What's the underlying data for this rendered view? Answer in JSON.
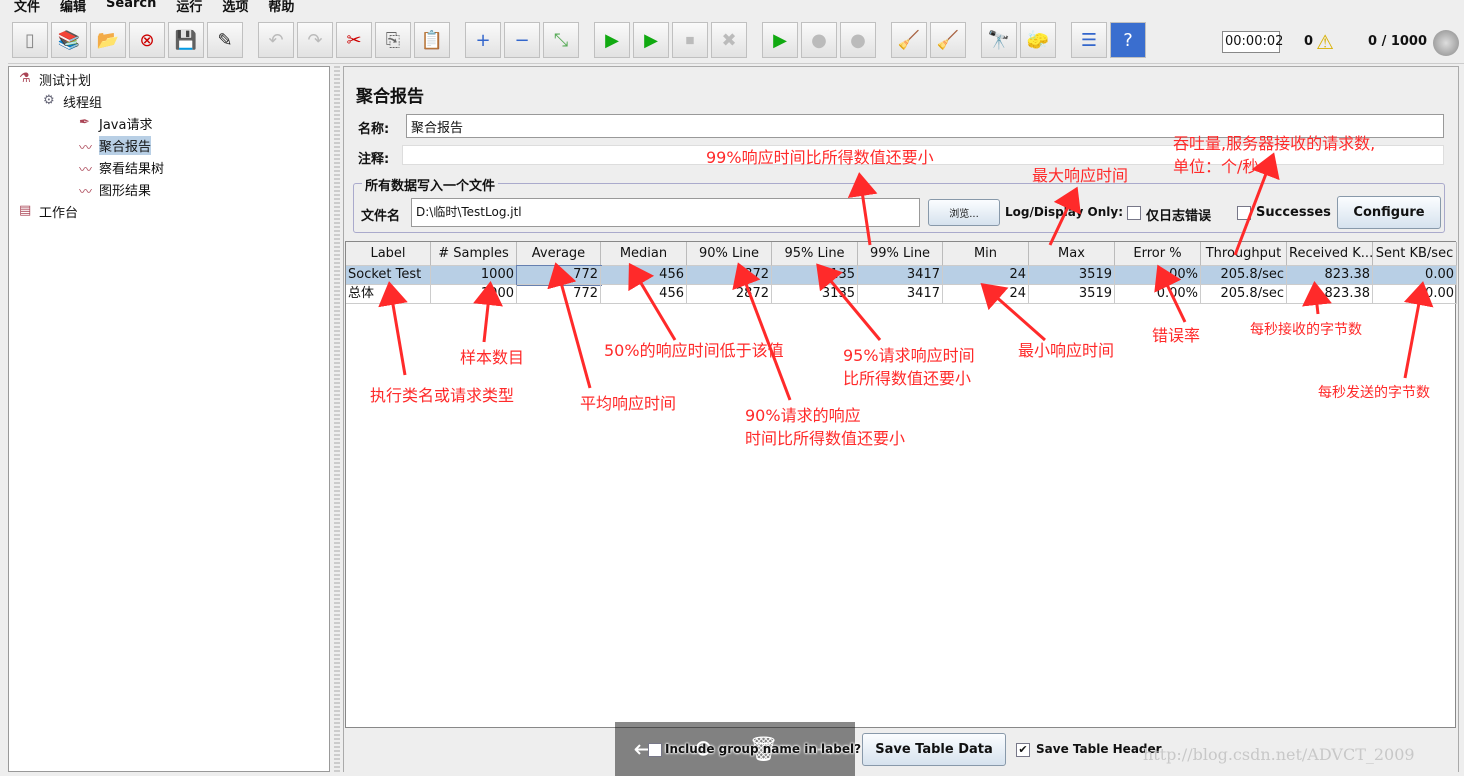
{
  "menu": [
    "文件",
    "编辑",
    "Search",
    "运行",
    "选项",
    "帮助"
  ],
  "toolbar": {
    "buttons": [
      "new-icon",
      "templates-icon",
      "open-icon",
      "close-icon",
      "save-icon",
      "save-as-icon",
      "undo-icon",
      "redo-icon",
      "cut-icon",
      "copy-icon",
      "paste-icon",
      "expand-icon",
      "collapse-icon",
      "toggle-icon",
      "start-icon",
      "start-no-pause-icon",
      "stop-icon",
      "shutdown-icon",
      "remote-start-icon",
      "remote-stop-icon",
      "remote-shutdown-icon",
      "clear-icon",
      "clear-all-icon",
      "search-icon",
      "reset-search-icon",
      "function-helper-icon",
      "help-icon"
    ],
    "timer": "00:00:02",
    "warnings": "0",
    "threads": "0 / 1000"
  },
  "tree": [
    {
      "label": "测试计划",
      "icon": "test-plan-icon"
    },
    {
      "label": "线程组",
      "icon": "gear-icon"
    },
    {
      "label": "Java请求",
      "icon": "sampler-icon"
    },
    {
      "label": "聚合报告",
      "icon": "listener-icon",
      "selected": true
    },
    {
      "label": "察看结果树",
      "icon": "listener-icon"
    },
    {
      "label": "图形结果",
      "icon": "listener-icon"
    },
    {
      "label": "工作台",
      "icon": "workbench-icon"
    }
  ],
  "panel": {
    "title": "聚合报告",
    "name_label": "名称:",
    "name_value": "聚合报告",
    "comment_label": "注释:",
    "comment_value": "",
    "file_group": "所有数据写入一个文件",
    "file_label": "文件名",
    "file_value": "D:\\临时\\TestLog.jtl",
    "browse": "浏览...",
    "log_only": "Log/Display Only:",
    "errors_only": "仅日志错误",
    "successes": "Successes",
    "configure": "Configure"
  },
  "table": {
    "columns": [
      "Label",
      "# Samples",
      "Average",
      "Median",
      "90% Line",
      "95% Line",
      "99% Line",
      "Min",
      "Max",
      "Error %",
      "Throughput",
      "Received K...",
      "Sent KB/sec"
    ],
    "rows": [
      [
        "Socket Test",
        "1000",
        "772",
        "456",
        "2872",
        "3135",
        "3417",
        "24",
        "3519",
        "0.00%",
        "205.8/sec",
        "823.38",
        "0.00"
      ],
      [
        "总体",
        "1000",
        "772",
        "456",
        "2872",
        "3135",
        "3417",
        "24",
        "3519",
        "0.00%",
        "205.8/sec",
        "823.38",
        "0.00"
      ]
    ]
  },
  "bottom": {
    "include_group": "Include group name in label?",
    "save_table": "Save Table Data",
    "save_header": "Save Table Header"
  },
  "watermark": "http://blog.csdn.net/ADVCT_2009",
  "annotations": {
    "label": "执行类名或请求类型",
    "samples": "样本数目",
    "average": "平均响应时间",
    "median": "50%的响应时间低于该值",
    "line90_1": "90%请求的响应",
    "line90_2": "时间比所得数值还要小",
    "line95_1": "95%请求响应时间",
    "line95_2": "比所得数值还要小",
    "line99": "99%响应时间比所得数值还要小",
    "max": "最大响应时间",
    "min": "最小响应时间",
    "error": "错误率",
    "throughput_1": "吞吐量,服务器接收的请求数,",
    "throughput_2": "单位：个/秒",
    "received": "每秒接收的字节数",
    "sent": "每秒发送的字节数"
  },
  "colors": {
    "annotation": "#ff2a2a",
    "selection": "#b8cfe5"
  }
}
